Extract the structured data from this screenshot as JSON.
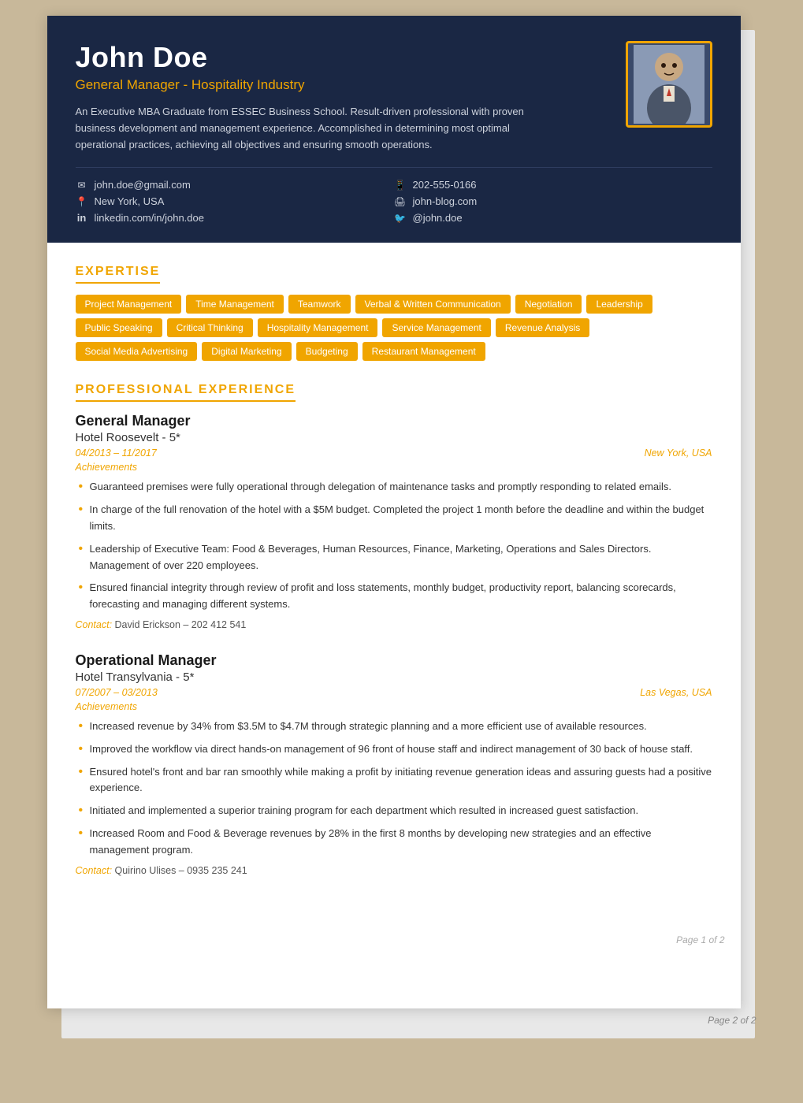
{
  "header": {
    "name": "John Doe",
    "title": "General Manager - Hospitality Industry",
    "bio": "An Executive MBA Graduate from ESSEC Business School. Result-driven professional with proven business development and management experience. Accomplished in determining most optimal operational practices, achieving all objectives and ensuring smooth operations.",
    "contacts": [
      {
        "icon": "✉",
        "value": "john.doe@gmail.com",
        "type": "email"
      },
      {
        "icon": "📞",
        "value": "202-555-0166",
        "type": "phone"
      },
      {
        "icon": "📍",
        "value": "New York, USA",
        "type": "location"
      },
      {
        "icon": "🌐",
        "value": "john-blog.com",
        "type": "website"
      },
      {
        "icon": "in",
        "value": "linkedin.com/in/john.doe",
        "type": "linkedin"
      },
      {
        "icon": "🐦",
        "value": "@john.doe",
        "type": "twitter"
      }
    ]
  },
  "expertise": {
    "section_title": "EXPERTISE",
    "tags": [
      "Project Management",
      "Time Management",
      "Teamwork",
      "Verbal & Written Communication",
      "Negotiation",
      "Leadership",
      "Public Speaking",
      "Critical Thinking",
      "Hospitality Management",
      "Service Management",
      "Revenue Analysis",
      "Social Media Advertising",
      "Digital Marketing",
      "Budgeting",
      "Restaurant Management"
    ]
  },
  "experience": {
    "section_title": "PROFESSIONAL EXPERIENCE",
    "jobs": [
      {
        "title": "General Manager",
        "company": "Hotel Roosevelt - 5*",
        "dates": "04/2013 – 11/2017",
        "location": "New York, USA",
        "achievements_label": "Achievements",
        "achievements": [
          "Guaranteed premises were fully operational through delegation of maintenance tasks and promptly responding to related emails.",
          "In charge of the full renovation of the hotel with a $5M budget. Completed the project 1 month before the deadline and within the budget limits.",
          "Leadership of Executive Team: Food & Beverages, Human Resources, Finance, Marketing, Operations and Sales Directors. Management of over 220 employees.",
          "Ensured financial integrity through review of profit and loss statements, monthly budget, productivity report, balancing scorecards, forecasting and managing different systems."
        ],
        "contact_label": "Contact:",
        "contact_value": "David Erickson – 202 412 541"
      },
      {
        "title": "Operational Manager",
        "company": "Hotel Transylvania - 5*",
        "dates": "07/2007 – 03/2013",
        "location": "Las Vegas, USA",
        "achievements_label": "Achievements",
        "achievements": [
          "Increased revenue by 34% from $3.5M to $4.7M through strategic planning and a more efficient use of available resources.",
          "Improved the workflow via direct hands-on management of 96 front of house staff and indirect management of 30 back of house staff.",
          "Ensured hotel's front and bar ran smoothly while making a profit by initiating revenue generation ideas and assuring guests had a positive experience.",
          "Initiated and implemented a superior training program for each department which resulted in increased guest satisfaction.",
          "Increased Room and Food & Beverage revenues by 28% in the first 8 months by developing new strategies and an effective management program."
        ],
        "contact_label": "Contact:",
        "contact_value": "Quirino Ulises – 0935 235 241"
      }
    ]
  },
  "page_number": "Page 1 of 2",
  "page2_label": "Page 2 of 2"
}
